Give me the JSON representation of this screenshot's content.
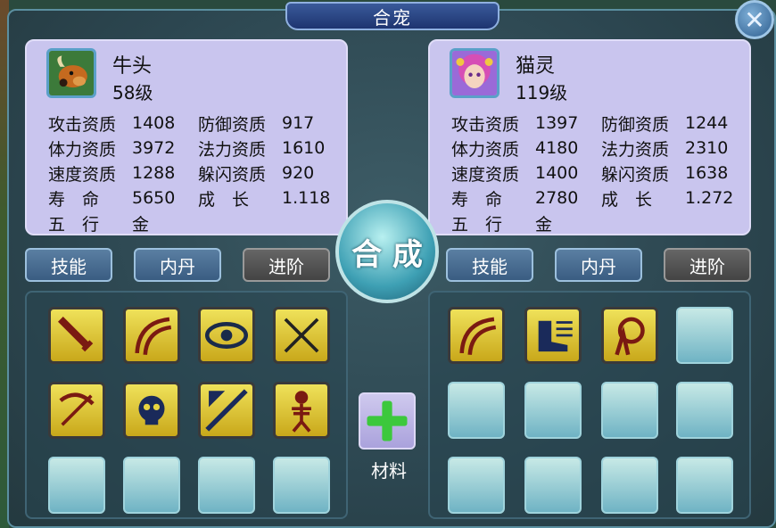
{
  "window": {
    "title": "合宠"
  },
  "left_pet": {
    "name": "牛头",
    "level": "58级",
    "stats": [
      [
        "攻击资质",
        "1408",
        "防御资质",
        "917"
      ],
      [
        "体力资质",
        "3972",
        "法力资质",
        "1610"
      ],
      [
        "速度资质",
        "1288",
        "躲闪资质",
        "920"
      ],
      [
        "寿　命",
        "5650",
        "成　长",
        "1.118"
      ],
      [
        "五　行",
        "金",
        "",
        ""
      ]
    ],
    "tabs": [
      "技能",
      "内丹",
      "进阶"
    ],
    "skills": [
      "sword-skill-icon",
      "claw-slash-icon",
      "eye-icon",
      "crossed-swords-icon",
      "broken-bow-icon",
      "skull-icon",
      "spear-strike-icon",
      "skeleton-icon"
    ],
    "empty_slots": 4
  },
  "right_pet": {
    "name": "猫灵",
    "level": "119级",
    "stats": [
      [
        "攻击资质",
        "1397",
        "防御资质",
        "1244"
      ],
      [
        "体力资质",
        "4180",
        "法力资质",
        "2310"
      ],
      [
        "速度资质",
        "1400",
        "躲闪资质",
        "1638"
      ],
      [
        "寿　命",
        "2780",
        "成　长",
        "1.272"
      ],
      [
        "五　行",
        "金",
        "",
        ""
      ]
    ],
    "tabs": [
      "技能",
      "内丹",
      "进阶"
    ],
    "skills": [
      "claw-slash-icon",
      "speed-boot-icon",
      "protect-shield-icon"
    ],
    "empty_slots": 9
  },
  "combine_label": "合 成",
  "material_label": "材料",
  "colors": {
    "panel": "#c9c5ee",
    "skill_bg": "#e8d440",
    "empty_slot": "#8ccad4"
  }
}
